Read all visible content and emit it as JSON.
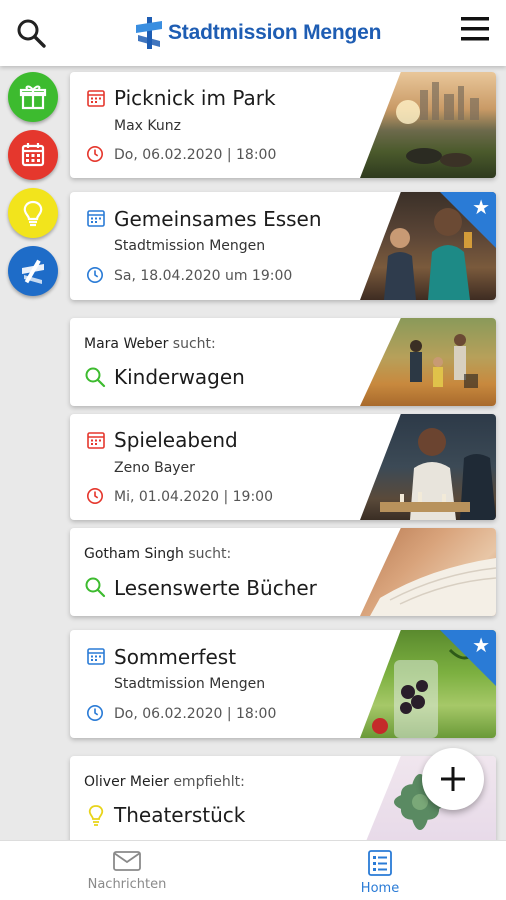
{
  "header": {
    "brand": "Stadtmission Mengen",
    "search_icon": "search-icon",
    "menu_icon": "hamburger-menu-icon",
    "brand_color": "#1e5db3"
  },
  "sidebar": {
    "categories": [
      {
        "icon": "gift-icon",
        "color": "#3dbb2f"
      },
      {
        "icon": "calendar-icon",
        "color": "#e5372d"
      },
      {
        "icon": "lightbulb-icon",
        "color": "#f2e41c"
      },
      {
        "icon": "stadtmission-logo-icon",
        "color": "#1e6cc8"
      }
    ]
  },
  "feed": [
    {
      "type": "event",
      "title": "Picknick im Park",
      "organizer": "Max Kunz",
      "date": "Do, 06.02.2020 | 18:00",
      "icon_color": "#e5372d",
      "featured": false,
      "image": "city-park-picnic-photo"
    },
    {
      "type": "event",
      "title": "Gemeinsames Essen",
      "organizer": "Stadtmission Mengen",
      "date": "Sa, 18.04.2020 um 19:00",
      "icon_color": "#2a7bd6",
      "featured": true,
      "image": "people-dining-photo"
    },
    {
      "type": "search",
      "person": "Mara Weber",
      "verb": "sucht:",
      "title": "Kinderwagen",
      "icon_color": "#3dbb2f",
      "image": "family-walking-park-photo"
    },
    {
      "type": "event",
      "title": "Spieleabend",
      "organizer": "Zeno Bayer",
      "date": "Mi, 01.04.2020 | 19:00",
      "icon_color": "#e5372d",
      "featured": false,
      "image": "chess-game-photo"
    },
    {
      "type": "search",
      "person": "Gotham Singh",
      "verb": "sucht:",
      "title": "Lesenswerte Bücher",
      "icon_color": "#3dbb2f",
      "image": "open-book-photo"
    },
    {
      "type": "event",
      "title": "Sommerfest",
      "organizer": "Stadtmission Mengen",
      "date": "Do, 06.02.2020 | 18:00",
      "icon_color": "#2a7bd6",
      "featured": true,
      "image": "berries-glass-photo"
    },
    {
      "type": "recommend",
      "person": "Oliver Meier",
      "verb": "empfiehlt:",
      "title": "Theaterstück",
      "icon_color": "#e8d41a",
      "image": "succulent-plant-photo"
    }
  ],
  "fab": {
    "icon": "plus-icon"
  },
  "bottom_nav": {
    "items": [
      {
        "label": "Nachrichten",
        "icon": "envelope-icon",
        "active": false
      },
      {
        "label": "Home",
        "icon": "list-document-icon",
        "active": true
      }
    ],
    "active_color": "#2a7bd6",
    "inactive_color": "#8a8a8a"
  }
}
